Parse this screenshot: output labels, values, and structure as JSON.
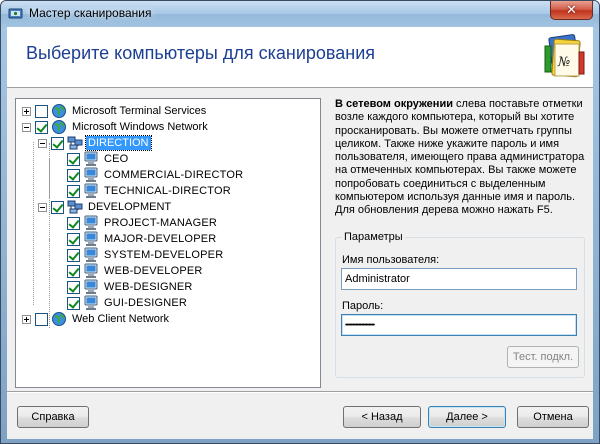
{
  "window": {
    "title": "Мастер сканирования",
    "close_glyph": "✕"
  },
  "header": {
    "heading": "Выберите компьютеры для сканирования",
    "icon": "wizard-notes-icon"
  },
  "tree": {
    "nodes": [
      {
        "label": "Microsoft Terminal Services",
        "checked": false,
        "expander": "plus",
        "icon": "globe-icon"
      },
      {
        "label": "Microsoft Windows Network",
        "checked": true,
        "expander": "minus",
        "icon": "globe-icon"
      },
      {
        "label": "DIRECTION",
        "checked": true,
        "expander": "minus",
        "icon": "workgroup-icon",
        "selected": true
      },
      {
        "label": "CEO",
        "checked": true,
        "icon": "computer-icon"
      },
      {
        "label": "COMMERCIAL-DIRECTOR",
        "checked": true,
        "icon": "computer-icon"
      },
      {
        "label": "TECHNICAL-DIRECTOR",
        "checked": true,
        "icon": "computer-icon"
      },
      {
        "label": "DEVELOPMENT",
        "checked": true,
        "expander": "minus",
        "icon": "workgroup-icon"
      },
      {
        "label": "PROJECT-MANAGER",
        "checked": true,
        "icon": "computer-icon"
      },
      {
        "label": "MAJOR-DEVELOPER",
        "checked": true,
        "icon": "computer-icon"
      },
      {
        "label": "SYSTEM-DEVELOPER",
        "checked": true,
        "icon": "computer-icon"
      },
      {
        "label": "WEB-DEVELOPER",
        "checked": true,
        "icon": "computer-icon"
      },
      {
        "label": "WEB-DESIGNER",
        "checked": true,
        "icon": "computer-icon"
      },
      {
        "label": "GUI-DESIGNER",
        "checked": true,
        "icon": "computer-icon"
      },
      {
        "label": "Web Client Network",
        "checked": false,
        "expander": "plus",
        "icon": "globe-icon"
      }
    ]
  },
  "info": {
    "bold": "В сетевом окружении",
    "text": "слева поставьте отметки возле каждого компьютера, который вы хотите просканировать. Вы можете отметчать группы целиком. Также ниже укажите пароль и имя пользователя, имеющего права администратора на отмеченных компьютерах. Вы также можете попробовать соединиться с выделенным компьютером используя данные имя и пароль. Для обновления дерева можно нажать F5."
  },
  "params": {
    "legend": "Параметры",
    "username_label": "Имя пользователя:",
    "username_value": "Administrator",
    "password_label": "Пароль:",
    "password_value": "••••••••••••••••••••",
    "test_button": "Тест. подкл."
  },
  "buttons": {
    "help": "Справка",
    "back": "< Назад",
    "next": "Далее >",
    "cancel": "Отмена"
  },
  "colors": {
    "heading": "#1c3f93",
    "selection": "#3399ff",
    "check": "#0b8a1b"
  }
}
